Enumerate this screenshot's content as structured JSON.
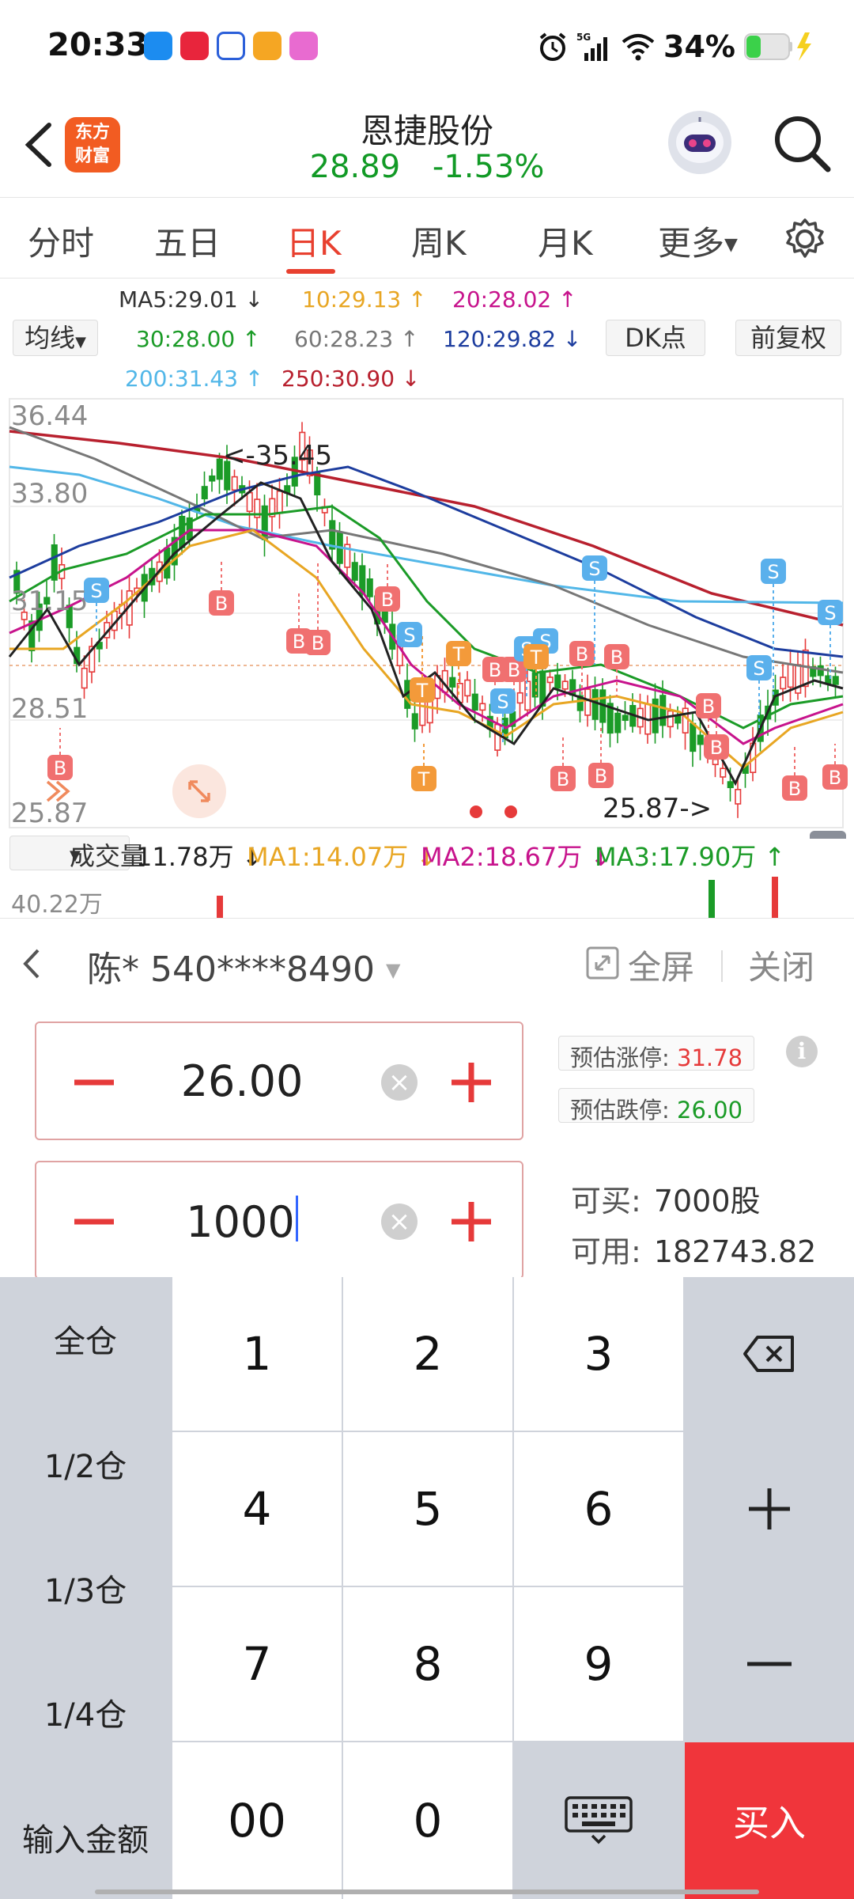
{
  "status_bar": {
    "time": "20:33",
    "network": "5G",
    "battery": "34%"
  },
  "header": {
    "brand_line1": "东方",
    "brand_line2": "财富",
    "stock_name": "恩捷股份",
    "price": "28.89",
    "change": "-1.53%",
    "icons": [
      "back-chevron-icon",
      "robot-avatar-icon",
      "search-icon"
    ]
  },
  "tabs": {
    "items": [
      {
        "label": "分时"
      },
      {
        "label": "五日"
      },
      {
        "label": "日K"
      },
      {
        "label": "周K"
      },
      {
        "label": "月K"
      },
      {
        "label": "更多"
      }
    ],
    "active": "日K"
  },
  "indicators": {
    "ma_selector": "均线",
    "ma": [
      {
        "text": "MA5:29.01 ↓",
        "color": "#333333"
      },
      {
        "text": "10:29.13 ↑",
        "color": "#e8a623"
      },
      {
        "text": "20:28.02 ↑",
        "color": "#c7138c"
      },
      {
        "text": "30:28.00 ↑",
        "color": "#1b9b27"
      },
      {
        "text": "60:28.23 ↑",
        "color": "#777777"
      },
      {
        "text": "120:29.82 ↓",
        "color": "#1d3d9e"
      },
      {
        "text": "200:31.43 ↑",
        "color": "#52b7e8"
      },
      {
        "text": "250:30.90 ↓",
        "color": "#b8202e"
      }
    ],
    "dk_button": "DK点",
    "adjust_button": "前复权"
  },
  "chart": {
    "price_labels": [
      "36.44",
      "33.80",
      "31.15",
      "28.51",
      "25.87"
    ],
    "high_marker": "<-35.45",
    "low_marker": "25.87->",
    "colors": {
      "up": "#e63a3a",
      "down": "#1b9b27",
      "buy_badge": "#f07070",
      "sell_badge": "#5ab0ec",
      "t_badge": "#f39a3a"
    }
  },
  "volume": {
    "selector": "成交量",
    "value": "11.78万 ↓",
    "ma1": "MA1:14.07万 ↓",
    "ma2": "MA2:18.67万 ↓",
    "ma3": "MA3:17.90万 ↑",
    "scale": "40.22万"
  },
  "trade": {
    "account": "陈* 540****8490",
    "fullscreen": "全屏",
    "close": "关闭",
    "price_value": "26.00",
    "quantity_value": "1000",
    "limit_up_label": "预估涨停:",
    "limit_up_value": "31.78",
    "limit_down_label": "预估跌停:",
    "limit_down_value": "26.00",
    "can_buy_label": "可买:",
    "can_buy_value": "7000股",
    "available_label": "可用:",
    "available_value": "182743.82"
  },
  "keypad": {
    "side": [
      "全仓",
      "1/2仓",
      "1/3仓",
      "1/4仓",
      "输入金额"
    ],
    "digits": [
      "1",
      "2",
      "3",
      "4",
      "5",
      "6",
      "7",
      "8",
      "9",
      "00",
      "0"
    ],
    "buy": "买入",
    "icons": [
      "backspace-icon",
      "plus-icon",
      "minus-icon",
      "keyboard-icon"
    ]
  }
}
